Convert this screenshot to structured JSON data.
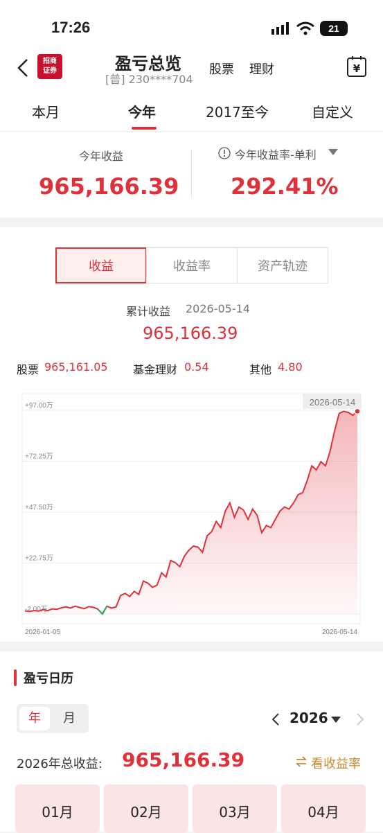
{
  "status": {
    "time": "17:26",
    "battery": "21"
  },
  "header": {
    "title": "盈亏总览",
    "account": "[普] 230****704",
    "links": [
      "股票",
      "理财"
    ],
    "logo_text": "招商证券"
  },
  "tabs": [
    "本月",
    "今年",
    "2017至今",
    "自定义"
  ],
  "active_tab": 1,
  "summary": {
    "profit_label": "今年收益",
    "profit_value": "965,166.39",
    "rate_label": "今年收益率-单利",
    "rate_value": "292.41%"
  },
  "segments": [
    "收益",
    "收益率",
    "资产轨迹"
  ],
  "cumulative": {
    "label": "累计收益",
    "date": "2026-05-14",
    "value": "965,166.39"
  },
  "breakdown": {
    "stock_label": "股票",
    "stock_value": "965,161.05",
    "fund_label": "基金理财",
    "fund_value": "0.54",
    "other_label": "其他",
    "other_value": "4.80"
  },
  "chart_data": {
    "type": "area",
    "x_start": "2026-01-05",
    "x_end": "2026-05-14",
    "tooltip_date": "2026-05-14",
    "y_ticks": [
      "+97.00万",
      "+72.25万",
      "+47.50万",
      "+22.75万",
      "-2.00万"
    ],
    "ylim": [
      -2.0,
      97.0
    ],
    "y_unit": "万",
    "values": [
      -0.5,
      -0.8,
      -0.3,
      -0.6,
      0.2,
      -0.4,
      0.5,
      0.3,
      1.0,
      1.5,
      0.9,
      1.8,
      1.2,
      0.6,
      1.6,
      1.3,
      0.4,
      -2.0,
      1.8,
      0.9,
      1.4,
      7.0,
      8.0,
      6.5,
      9.0,
      7.5,
      14.0,
      13.0,
      11.0,
      12.0,
      18.0,
      16.0,
      24.0,
      23.0,
      21.0,
      26.0,
      29.0,
      31.0,
      30.5,
      28.0,
      36.0,
      38.0,
      43.0,
      40.0,
      48.0,
      52.0,
      45.0,
      50.0,
      48.5,
      44.0,
      49.0,
      46.0,
      37.5,
      41.0,
      40.0,
      44.0,
      48.0,
      50.0,
      49.0,
      52.0,
      56.0,
      57.0,
      63.0,
      70.0,
      68.0,
      72.0,
      70.0,
      77.0,
      87.0,
      95.5,
      96.5,
      96.0,
      94.5,
      96.5
    ],
    "line_color": "#e0303a",
    "negative_color": "#2fa84f"
  },
  "calendar": {
    "title": "盈亏日历",
    "toggle": [
      "年",
      "月"
    ],
    "year": "2026",
    "total_label": "2026年总收益:",
    "total_value": "965,166.39",
    "rate_link": "看收益率",
    "months": [
      "01月",
      "02月",
      "03月",
      "04月"
    ]
  }
}
